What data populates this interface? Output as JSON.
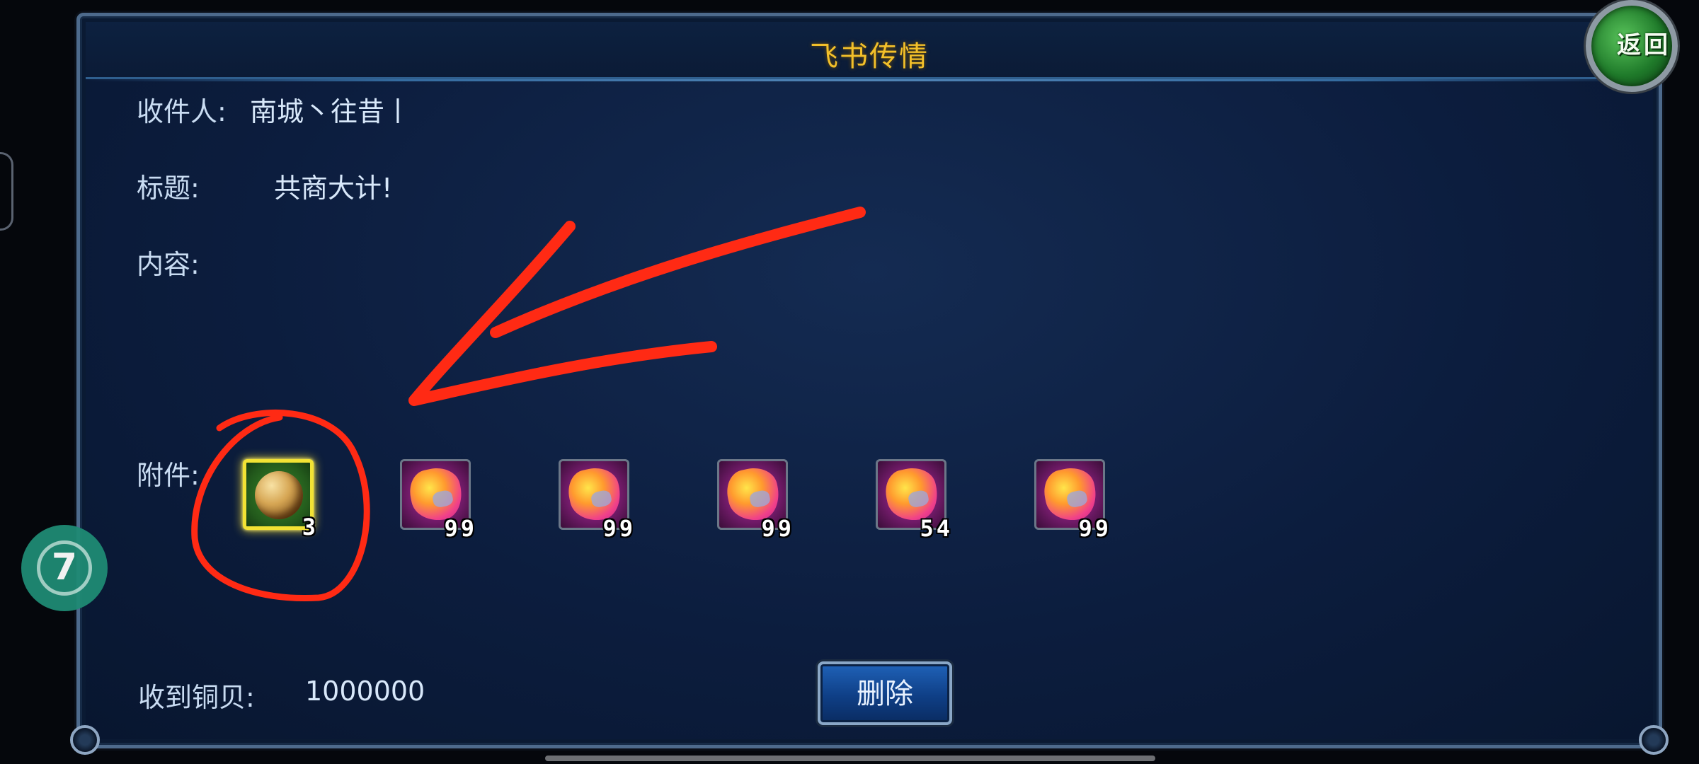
{
  "dialog": {
    "title": "飞书传情"
  },
  "mail": {
    "recipient_label": "收件人:",
    "recipient_value": "南城丶往昔丨",
    "subject_label": "标题:",
    "subject_value": "共商大计!",
    "content_label": "内容:",
    "content_value": "",
    "attachments_label": "附件:",
    "attachments": [
      {
        "icon": "gold-ore-icon",
        "count": "3",
        "selected": true
      },
      {
        "icon": "magenta-gem-icon",
        "count": "99",
        "selected": false
      },
      {
        "icon": "magenta-gem-icon",
        "count": "99",
        "selected": false
      },
      {
        "icon": "magenta-gem-icon",
        "count": "99",
        "selected": false
      },
      {
        "icon": "magenta-gem-icon",
        "count": "54",
        "selected": false
      },
      {
        "icon": "magenta-gem-icon",
        "count": "99",
        "selected": false
      }
    ],
    "copper_label": "收到铜贝:",
    "copper_value": "1000000"
  },
  "buttons": {
    "delete": "删除",
    "back": "返回"
  },
  "floating": {
    "assistant_glyph": "7"
  },
  "colors": {
    "title": "#f3c02a",
    "label": "#c9dcf2",
    "annotation": "#ff2a14",
    "selected_slot": "#f2e234"
  }
}
